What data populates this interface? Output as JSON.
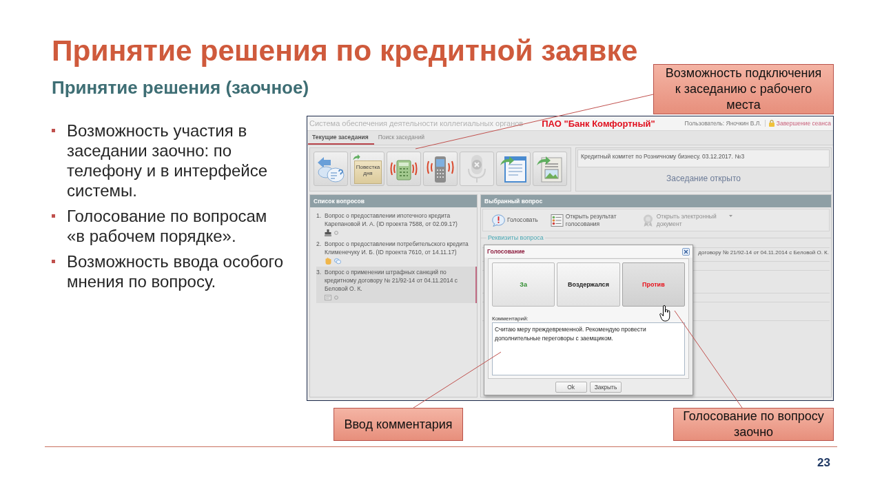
{
  "title": "Принятие решения по кредитной заявке",
  "subtitle": "Принятие решения (заочное)",
  "bullets": [
    "Возможность участия в заседании заочно: по телефону и в интерфейсе системы.",
    "Голосование по вопросам «в рабочем порядке».",
    "Возможность ввода особого мнения по вопросу."
  ],
  "app": {
    "header": {
      "system_title": "Система обеспечения деятельности коллегиальных органов",
      "brand": "ПАО \"Банк Комфортный\"",
      "user": "Пользователь: Яночкин В.Л.",
      "logout": "Завершение сеанса"
    },
    "tabs": [
      {
        "label": "Текущие заседания",
        "selected": true
      },
      {
        "label": "Поиск заседаний",
        "selected": false
      }
    ],
    "toolbar": [
      {
        "kind": "questions",
        "disabled": false
      },
      {
        "kind": "agenda",
        "disabled": false,
        "caption": "Повестка дня"
      },
      {
        "kind": "phone",
        "disabled": false
      },
      {
        "kind": "mobile",
        "disabled": false
      },
      {
        "kind": "microphone",
        "disabled": true
      },
      {
        "kind": "document",
        "disabled": false
      },
      {
        "kind": "picture",
        "disabled": false
      }
    ],
    "meeting": {
      "name": "Кредитный комитет по Розничному бизнесу. 03.12.2017. №3",
      "status": "Заседание открыто"
    },
    "questions": {
      "title": "Список вопросов",
      "items": [
        {
          "number": "1.",
          "text": "Вопрос о предоставлении ипотечного кредита Карепановой И. А. (ID проекта 7588, от 02.09.17)",
          "selected": false
        },
        {
          "number": "2.",
          "text": "Вопрос о предоставлении потребительского кредита Клименечуку И. Б. (ID проекта 7610, от 14.11.17)",
          "selected": false
        },
        {
          "number": "3.",
          "text": "Вопрос о применении штрафных санкций по кредитному договору № 21/92-14 от 04.11.2014 с Беловой О. К.",
          "selected": true
        }
      ]
    },
    "selected_question": {
      "title": "Выбранный вопрос",
      "actions": [
        {
          "kind": "vote",
          "label": "Голосовать",
          "disabled": false,
          "has_menu": false
        },
        {
          "kind": "results",
          "label": "Открыть результат голосования",
          "disabled": false,
          "has_menu": false
        },
        {
          "kind": "document",
          "label": "Открыть электронный документ",
          "disabled": true,
          "has_menu": true
        }
      ],
      "details": {
        "legend": "Реквизиты вопроса",
        "rows": [
          "договору № 21/92-14 от 04.11.2014 с Беловой О. К."
        ]
      }
    },
    "dialog": {
      "title": "Голосование",
      "options": [
        {
          "label": "За",
          "color": "#2a8a2a",
          "hovered": false
        },
        {
          "label": "Воздержался",
          "color": "#222222",
          "hovered": false
        },
        {
          "label": "Против",
          "color": "#e8101a",
          "hovered": true
        }
      ],
      "comment_label": "Комментарий:",
      "comment": "Считаю меру преждевременной. Рекомендую провести дополнительные переговоры с заемщиком.",
      "buttons": [
        "Ok",
        "Закрыть"
      ]
    }
  },
  "callouts": [
    "Возможность подключения к заседанию с рабочего места",
    "Ввод комментария",
    "Голосование по вопросу заочно"
  ],
  "page_number": "23"
}
